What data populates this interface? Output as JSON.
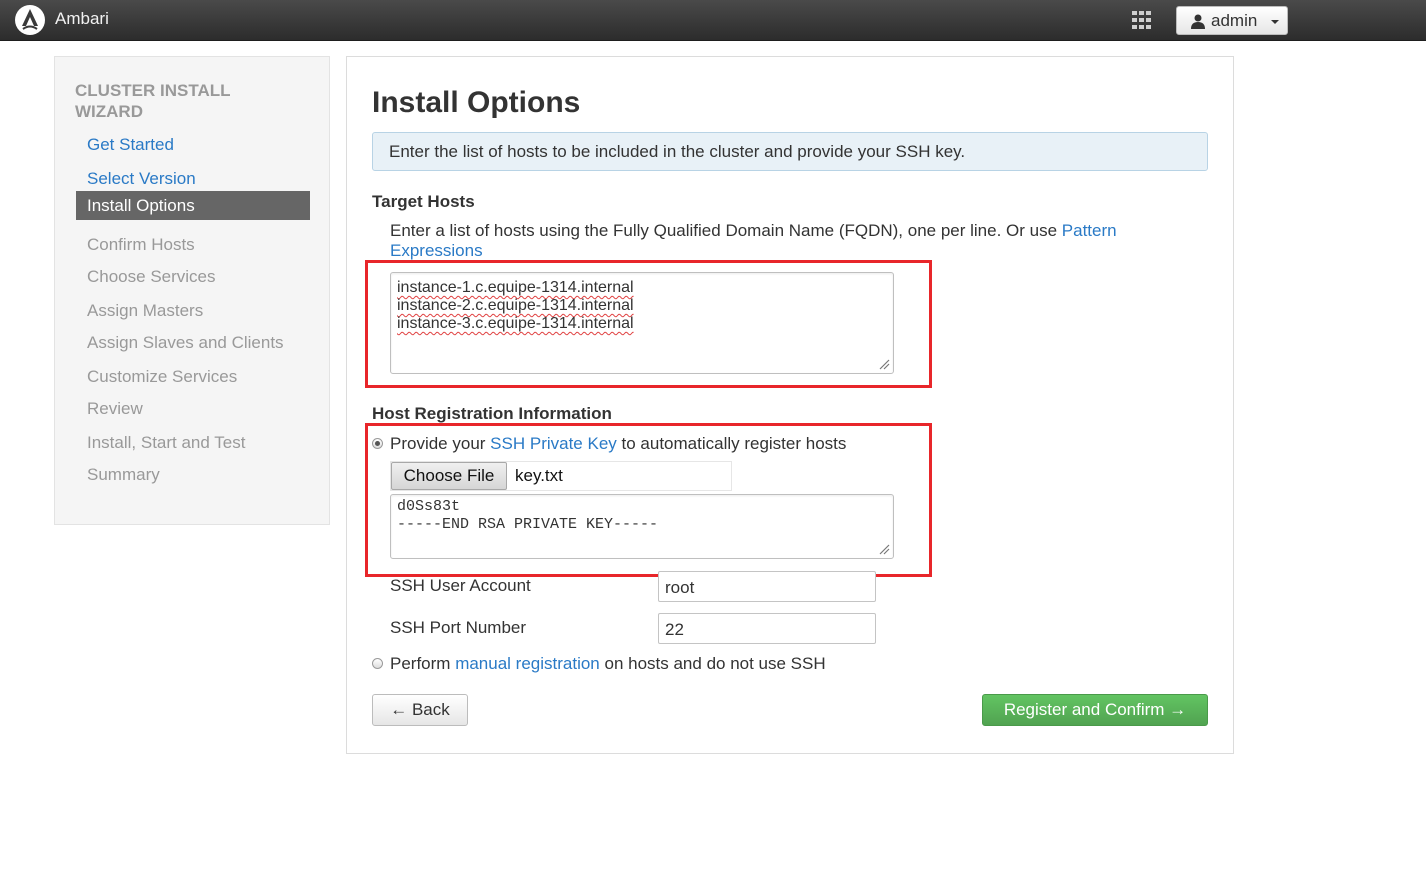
{
  "navbar": {
    "brand": "Ambari",
    "logo_icon": "ambari-logo",
    "apps_icon": "grid-icon",
    "user_label": "admin",
    "user_icon": "user-icon"
  },
  "sidebar": {
    "title": "CLUSTER INSTALL WIZARD",
    "items": [
      {
        "label": "Get Started",
        "state": "done"
      },
      {
        "label": "Select Version",
        "state": "done"
      },
      {
        "label": "Install Options",
        "state": "active"
      },
      {
        "label": "Confirm Hosts",
        "state": "todo"
      },
      {
        "label": "Choose Services",
        "state": "todo"
      },
      {
        "label": "Assign Masters",
        "state": "todo"
      },
      {
        "label": "Assign Slaves and Clients",
        "state": "todo"
      },
      {
        "label": "Customize Services",
        "state": "todo"
      },
      {
        "label": "Review",
        "state": "todo"
      },
      {
        "label": "Install, Start and Test",
        "state": "todo"
      },
      {
        "label": "Summary",
        "state": "todo"
      }
    ]
  },
  "main": {
    "title": "Install Options",
    "info": "Enter the list of hosts to be included in the cluster and provide your SSH key.",
    "target_hosts": {
      "heading": "Target Hosts",
      "help_prefix": "Enter a list of hosts using the Fully Qualified Domain Name (FQDN), one per line. Or use ",
      "help_link": "Pattern Expressions",
      "hosts": [
        "instance-1.c.equipe-1314.internal",
        "instance-2.c.equipe-1314.internal",
        "instance-3.c.equipe-1314.internal"
      ]
    },
    "registration": {
      "heading": "Host Registration Information",
      "ssh_option_prefix": "Provide your ",
      "ssh_option_link": "SSH Private Key",
      "ssh_option_suffix": " to automatically register hosts",
      "ssh_selected": true,
      "choose_file_label": "Choose File",
      "file_name": "key.txt",
      "key_lines": [
        "d0Ss83t",
        "-----END RSA PRIVATE KEY-----"
      ],
      "user_account_label": "SSH User Account",
      "user_account_value": "root",
      "port_label": "SSH Port Number",
      "port_value": "22",
      "manual_prefix": "Perform ",
      "manual_link": "manual registration",
      "manual_suffix": " on hosts and do not use SSH",
      "manual_selected": false
    },
    "buttons": {
      "back": "← Back",
      "next": "Register and Confirm →"
    }
  },
  "colors": {
    "link": "#2a7ac6",
    "success": "#51a351",
    "highlight": "#e8262a",
    "navbar": "#333333"
  }
}
